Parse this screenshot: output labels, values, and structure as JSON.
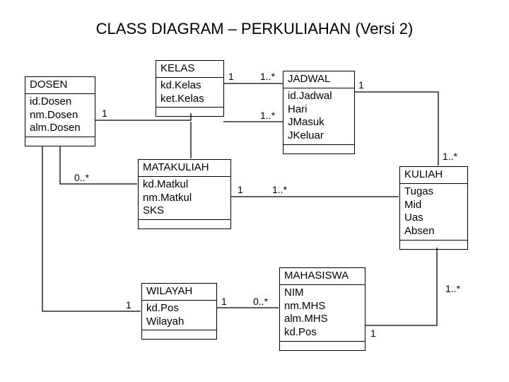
{
  "title": "CLASS DIAGRAM – PERKULIAHAN (Versi 2)",
  "classes": {
    "dosen": {
      "name": "DOSEN",
      "attrs": [
        "id.Dosen",
        "nm.Dosen",
        "alm.Dosen"
      ]
    },
    "kelas": {
      "name": "KELAS",
      "attrs": [
        "kd.Kelas",
        "ket.Kelas"
      ]
    },
    "jadwal": {
      "name": "JADWAL",
      "attrs": [
        "id.Jadwal",
        "Hari",
        "JMasuk",
        "JKeluar"
      ]
    },
    "matakuliah": {
      "name": "MATAKULIAH",
      "attrs": [
        "kd.Matkul",
        "nm.Matkul",
        "SKS"
      ]
    },
    "kuliah": {
      "name": "KULIAH",
      "attrs": [
        "Tugas",
        "Mid",
        "Uas",
        "Absen"
      ]
    },
    "wilayah": {
      "name": "WILAYAH",
      "attrs": [
        "kd.Pos",
        "Wilayah"
      ]
    },
    "mahasiswa": {
      "name": "MAHASISWA",
      "attrs": [
        "NIM",
        "nm.MHS",
        "alm.MHS",
        "kd.Pos"
      ]
    }
  },
  "mult": {
    "dosen_kelas_1": "1",
    "kelas_jadwal_1": "1",
    "kelas_jadwal_n": "1..*",
    "matkul_jadwal_n": "1..*",
    "jadwal_kuliah_1": "1",
    "jadwal_kuliah_n": "1..*",
    "dosen_matkul_n": "0..*",
    "matkul_kuliah_1": "1",
    "matkul_kuliah_n": "1..*",
    "dosen_wilayah_1": "1",
    "wilayah_mhs_1": "1",
    "wilayah_mhs_n": "0..*",
    "mhs_kuliah_1": "1",
    "mhs_kuliah_n": "1..*"
  }
}
